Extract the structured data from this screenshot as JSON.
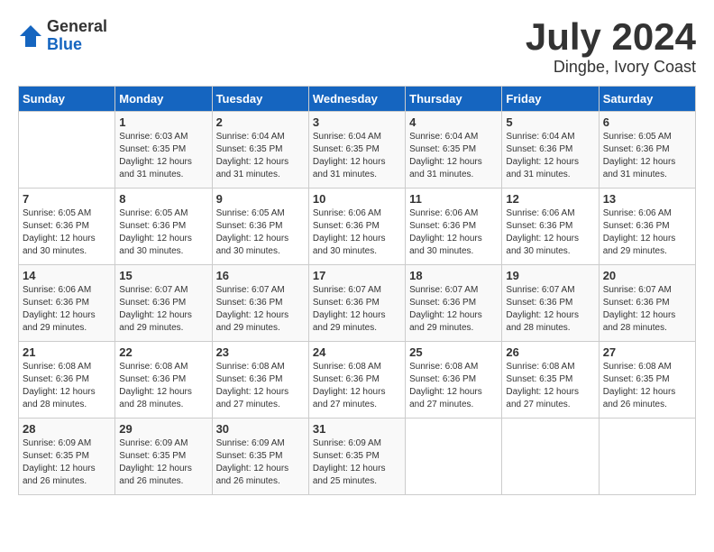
{
  "logo": {
    "general": "General",
    "blue": "Blue"
  },
  "title": "July 2024",
  "location": "Dingbe, Ivory Coast",
  "days_of_week": [
    "Sunday",
    "Monday",
    "Tuesday",
    "Wednesday",
    "Thursday",
    "Friday",
    "Saturday"
  ],
  "weeks": [
    [
      {
        "day": "",
        "info": ""
      },
      {
        "day": "1",
        "info": "Sunrise: 6:03 AM\nSunset: 6:35 PM\nDaylight: 12 hours\nand 31 minutes."
      },
      {
        "day": "2",
        "info": "Sunrise: 6:04 AM\nSunset: 6:35 PM\nDaylight: 12 hours\nand 31 minutes."
      },
      {
        "day": "3",
        "info": "Sunrise: 6:04 AM\nSunset: 6:35 PM\nDaylight: 12 hours\nand 31 minutes."
      },
      {
        "day": "4",
        "info": "Sunrise: 6:04 AM\nSunset: 6:35 PM\nDaylight: 12 hours\nand 31 minutes."
      },
      {
        "day": "5",
        "info": "Sunrise: 6:04 AM\nSunset: 6:36 PM\nDaylight: 12 hours\nand 31 minutes."
      },
      {
        "day": "6",
        "info": "Sunrise: 6:05 AM\nSunset: 6:36 PM\nDaylight: 12 hours\nand 31 minutes."
      }
    ],
    [
      {
        "day": "7",
        "info": "Sunrise: 6:05 AM\nSunset: 6:36 PM\nDaylight: 12 hours\nand 30 minutes."
      },
      {
        "day": "8",
        "info": "Sunrise: 6:05 AM\nSunset: 6:36 PM\nDaylight: 12 hours\nand 30 minutes."
      },
      {
        "day": "9",
        "info": "Sunrise: 6:05 AM\nSunset: 6:36 PM\nDaylight: 12 hours\nand 30 minutes."
      },
      {
        "day": "10",
        "info": "Sunrise: 6:06 AM\nSunset: 6:36 PM\nDaylight: 12 hours\nand 30 minutes."
      },
      {
        "day": "11",
        "info": "Sunrise: 6:06 AM\nSunset: 6:36 PM\nDaylight: 12 hours\nand 30 minutes."
      },
      {
        "day": "12",
        "info": "Sunrise: 6:06 AM\nSunset: 6:36 PM\nDaylight: 12 hours\nand 30 minutes."
      },
      {
        "day": "13",
        "info": "Sunrise: 6:06 AM\nSunset: 6:36 PM\nDaylight: 12 hours\nand 29 minutes."
      }
    ],
    [
      {
        "day": "14",
        "info": "Sunrise: 6:06 AM\nSunset: 6:36 PM\nDaylight: 12 hours\nand 29 minutes."
      },
      {
        "day": "15",
        "info": "Sunrise: 6:07 AM\nSunset: 6:36 PM\nDaylight: 12 hours\nand 29 minutes."
      },
      {
        "day": "16",
        "info": "Sunrise: 6:07 AM\nSunset: 6:36 PM\nDaylight: 12 hours\nand 29 minutes."
      },
      {
        "day": "17",
        "info": "Sunrise: 6:07 AM\nSunset: 6:36 PM\nDaylight: 12 hours\nand 29 minutes."
      },
      {
        "day": "18",
        "info": "Sunrise: 6:07 AM\nSunset: 6:36 PM\nDaylight: 12 hours\nand 29 minutes."
      },
      {
        "day": "19",
        "info": "Sunrise: 6:07 AM\nSunset: 6:36 PM\nDaylight: 12 hours\nand 28 minutes."
      },
      {
        "day": "20",
        "info": "Sunrise: 6:07 AM\nSunset: 6:36 PM\nDaylight: 12 hours\nand 28 minutes."
      }
    ],
    [
      {
        "day": "21",
        "info": "Sunrise: 6:08 AM\nSunset: 6:36 PM\nDaylight: 12 hours\nand 28 minutes."
      },
      {
        "day": "22",
        "info": "Sunrise: 6:08 AM\nSunset: 6:36 PM\nDaylight: 12 hours\nand 28 minutes."
      },
      {
        "day": "23",
        "info": "Sunrise: 6:08 AM\nSunset: 6:36 PM\nDaylight: 12 hours\nand 27 minutes."
      },
      {
        "day": "24",
        "info": "Sunrise: 6:08 AM\nSunset: 6:36 PM\nDaylight: 12 hours\nand 27 minutes."
      },
      {
        "day": "25",
        "info": "Sunrise: 6:08 AM\nSunset: 6:36 PM\nDaylight: 12 hours\nand 27 minutes."
      },
      {
        "day": "26",
        "info": "Sunrise: 6:08 AM\nSunset: 6:35 PM\nDaylight: 12 hours\nand 27 minutes."
      },
      {
        "day": "27",
        "info": "Sunrise: 6:08 AM\nSunset: 6:35 PM\nDaylight: 12 hours\nand 26 minutes."
      }
    ],
    [
      {
        "day": "28",
        "info": "Sunrise: 6:09 AM\nSunset: 6:35 PM\nDaylight: 12 hours\nand 26 minutes."
      },
      {
        "day": "29",
        "info": "Sunrise: 6:09 AM\nSunset: 6:35 PM\nDaylight: 12 hours\nand 26 minutes."
      },
      {
        "day": "30",
        "info": "Sunrise: 6:09 AM\nSunset: 6:35 PM\nDaylight: 12 hours\nand 26 minutes."
      },
      {
        "day": "31",
        "info": "Sunrise: 6:09 AM\nSunset: 6:35 PM\nDaylight: 12 hours\nand 25 minutes."
      },
      {
        "day": "",
        "info": ""
      },
      {
        "day": "",
        "info": ""
      },
      {
        "day": "",
        "info": ""
      }
    ]
  ]
}
